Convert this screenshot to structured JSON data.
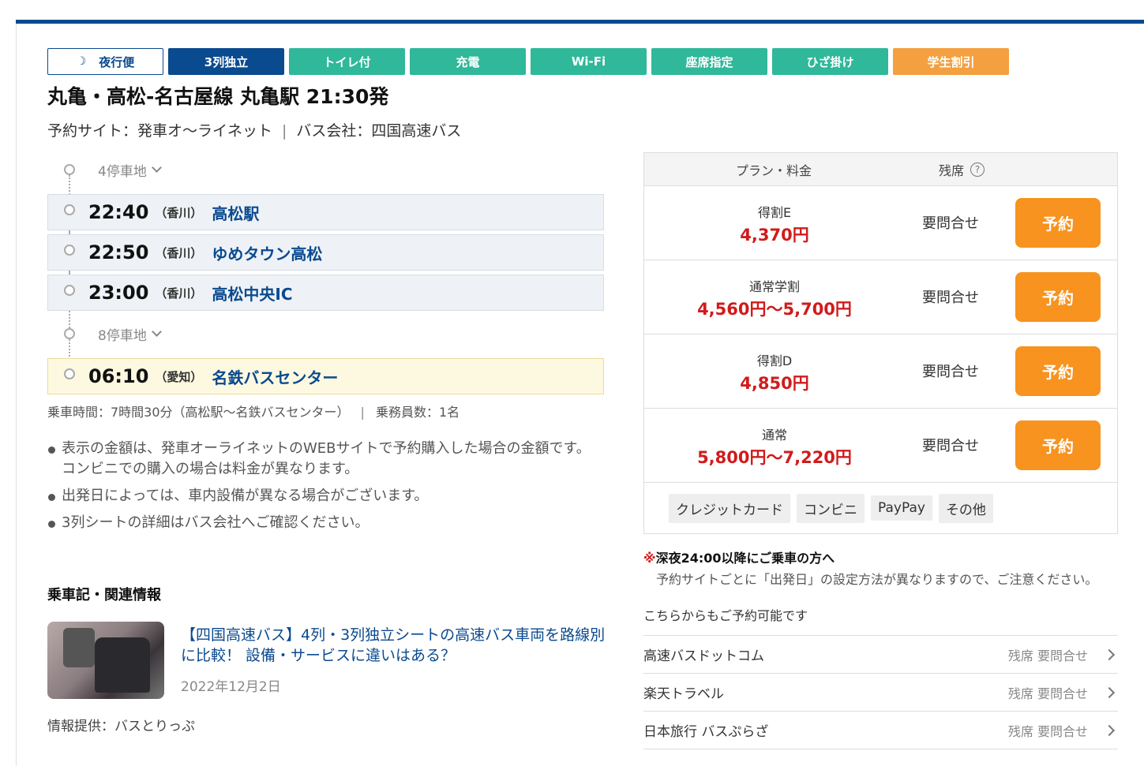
{
  "features": [
    {
      "label": "夜行便",
      "style": "night"
    },
    {
      "label": "3列独立",
      "style": "blue"
    },
    {
      "label": "トイレ付",
      "style": "green"
    },
    {
      "label": "充電",
      "style": "green"
    },
    {
      "label": "Wi-Fi",
      "style": "green"
    },
    {
      "label": "座席指定",
      "style": "green"
    },
    {
      "label": "ひざ掛け",
      "style": "green"
    },
    {
      "label": "学生割引",
      "style": "orange"
    }
  ],
  "title": "丸亀・高松-名古屋線 丸亀駅 21:30発",
  "site_label": "予約サイト：発車オ～ライネット",
  "company_label": "バス会社：四国高速バス",
  "route": {
    "collapsed_before": "4停車地",
    "stops": [
      {
        "time": "22:40",
        "pref": "（香川）",
        "name": "高松駅"
      },
      {
        "time": "22:50",
        "pref": "（香川）",
        "name": "ゆめタウン高松"
      },
      {
        "time": "23:00",
        "pref": "（香川）",
        "name": "高松中央IC"
      }
    ],
    "collapsed_middle": "8停車地",
    "arrival": {
      "time": "06:10",
      "pref": "（愛知）",
      "name": "名鉄バスセンター"
    }
  },
  "ride_time": "乗車時間：7時間30分（高松駅～名鉄バスセンター）",
  "crew": "乗務員数：1名",
  "notes": [
    "表示の金額は、発車オーライネットのWEBサイトで予約購入した場合の金額です。コンビニでの購入の場合は料金が異なります。",
    "出発日によっては、車内設備が異なる場合がございます。",
    "3列シートの詳細はバス会社へご確認ください。"
  ],
  "related": {
    "heading": "乗車記・関連情報",
    "article_title": "【四国高速バス】4列・3列独立シートの高速バス車両を路線別に比較！ 設備・サービスに違いはある？",
    "article_date": "2022年12月2日",
    "provider": "情報提供：バスとりっぷ"
  },
  "plans": {
    "col_plan": "プラン・料金",
    "col_seats": "残席",
    "help_icon": "?",
    "reserve_label": "予約",
    "items": [
      {
        "name": "得割E",
        "price": "4,370円",
        "avail": "要問合せ"
      },
      {
        "name": "通常学割",
        "price": "4,560円～5,700円",
        "avail": "要問合せ"
      },
      {
        "name": "得割D",
        "price": "4,850円",
        "avail": "要問合せ"
      },
      {
        "name": "通常",
        "price": "5,800円～7,220円",
        "avail": "要問合せ"
      }
    ],
    "payments": [
      "クレジットカード",
      "コンビニ",
      "PayPay",
      "その他"
    ]
  },
  "late_note": {
    "mark": "※",
    "heading": "深夜24:00以降にご乗車の方へ",
    "body": "予約サイトごとに「出発日」の設定方法が異なりますので、ご注意ください。"
  },
  "alt_sites": {
    "heading": "こちらからもご予約可能です",
    "items": [
      {
        "name": "高速バスドットコム",
        "status": "残席 要問合せ"
      },
      {
        "name": "楽天トラベル",
        "status": "残席 要問合せ"
      },
      {
        "name": "日本旅行 バスぷらざ",
        "status": "残席 要問合せ"
      }
    ]
  },
  "colors": {
    "brand_blue": "#0a4a8f",
    "feature_green": "#2fb89a",
    "feature_orange": "#f4a040",
    "price_red": "#d11b1b",
    "reserve_orange": "#f7931e"
  }
}
